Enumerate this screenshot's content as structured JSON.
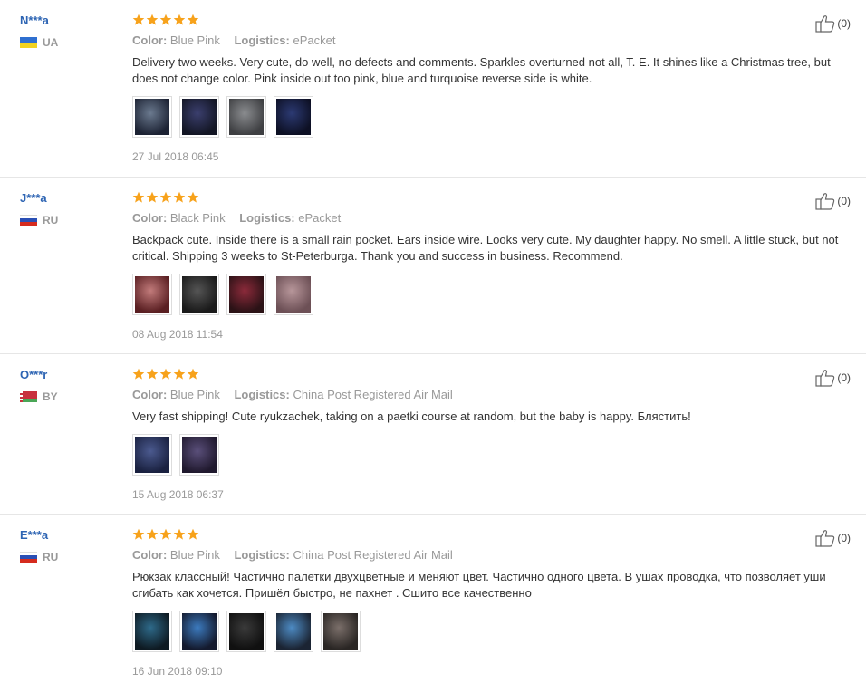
{
  "reviews": [
    {
      "buyer": "N***a",
      "country_code": "UA",
      "flag_colors": [
        "#2f6fd0",
        "#f2d21f"
      ],
      "rating": 5,
      "color_label": "Color:",
      "color_value": "Blue Pink",
      "logistics_label": "Logistics:",
      "logistics_value": "ePacket",
      "text": "Delivery two weeks. Very cute, do well, no defects and comments. Sparkles overturned not all, T. E. It shines like a Christmas tree, but does not change color. Pink inside out too pink, blue and turquoise reverse side is white.",
      "photos": [
        {
          "icon": "backpack-photo",
          "colors": [
            "#6b7a8f",
            "#1c2233"
          ]
        },
        {
          "icon": "backpack-photo",
          "colors": [
            "#3b3f6e",
            "#131624"
          ]
        },
        {
          "icon": "backpack-photo",
          "colors": [
            "#8a8c8f",
            "#3e3f42"
          ]
        },
        {
          "icon": "backpack-photo",
          "colors": [
            "#2c3a73",
            "#0d1024"
          ]
        }
      ],
      "date": "27 Jul 2018 06:45",
      "helpful_count": "(0)"
    },
    {
      "buyer": "J***a",
      "country_code": "RU",
      "flag_colors": [
        "#ffffff",
        "#2a4fb5",
        "#d52b1e"
      ],
      "rating": 5,
      "color_label": "Color:",
      "color_value": "Black Pink",
      "logistics_label": "Logistics:",
      "logistics_value": "ePacket",
      "text": "Backpack cute. Inside there is a small rain pocket. Ears inside wire. Looks very cute. My daughter happy. No smell. A little stuck, but not critical. Shipping 3 weeks to St-Peterburga. Thank you and success in business. Recommend.",
      "photos": [
        {
          "icon": "backpack-photo",
          "colors": [
            "#c27b7b",
            "#5a1f22"
          ]
        },
        {
          "icon": "backpack-photo",
          "colors": [
            "#555555",
            "#1a1a1a"
          ]
        },
        {
          "icon": "backpack-photo",
          "colors": [
            "#8b2a3a",
            "#2b1216"
          ]
        },
        {
          "icon": "backpack-photo",
          "colors": [
            "#b7969a",
            "#6d5056"
          ]
        }
      ],
      "date": "08 Aug 2018 11:54",
      "helpful_count": "(0)"
    },
    {
      "buyer": "O***r",
      "country_code": "BY",
      "flag_colors": [
        "#c8313e",
        "#4aa657"
      ],
      "rating": 5,
      "color_label": "Color:",
      "color_value": "Blue Pink",
      "logistics_label": "Logistics:",
      "logistics_value": "China Post Registered Air Mail",
      "text": "Very fast shipping! Cute ryukzachek, taking on a paetki course at random, but the baby is happy. Блястить!",
      "photos": [
        {
          "icon": "backpack-photo",
          "colors": [
            "#4b5a8f",
            "#1a2140"
          ]
        },
        {
          "icon": "backpack-photo",
          "colors": [
            "#5a4f7a",
            "#20192e"
          ]
        }
      ],
      "date": "15 Aug 2018 06:37",
      "helpful_count": "(0)"
    },
    {
      "buyer": "E***a",
      "country_code": "RU",
      "flag_colors": [
        "#ffffff",
        "#2a4fb5",
        "#d52b1e"
      ],
      "rating": 5,
      "color_label": "Color:",
      "color_value": "Blue Pink",
      "logistics_label": "Logistics:",
      "logistics_value": "China Post Registered Air Mail",
      "text": "Рюкзак классный! Частично палетки двухцветные и меняют цвет. Частично одного цвета. В ушах проводка, что позволяет уши сгибать как хочется. Пришёл быстро, не пахнет . Сшито все качественно",
      "photos": [
        {
          "icon": "backpack-photo",
          "colors": [
            "#2e6a8a",
            "#0e1a22"
          ]
        },
        {
          "icon": "backpack-photo",
          "colors": [
            "#3c7bbf",
            "#141a2e"
          ]
        },
        {
          "icon": "backpack-photo",
          "colors": [
            "#3a3a3a",
            "#101010"
          ]
        },
        {
          "icon": "backpack-photo",
          "colors": [
            "#4d8bc4",
            "#1b2433"
          ]
        },
        {
          "icon": "backpack-photo",
          "colors": [
            "#7b6f6a",
            "#2a2624"
          ]
        }
      ],
      "date": "16 Jun 2018 09:10",
      "helpful_count": "(0)"
    }
  ],
  "colors": {
    "buyer_name": "#2d64b3",
    "star": "#f7a21b",
    "muted": "#999999",
    "divider": "#e6e6e6"
  }
}
